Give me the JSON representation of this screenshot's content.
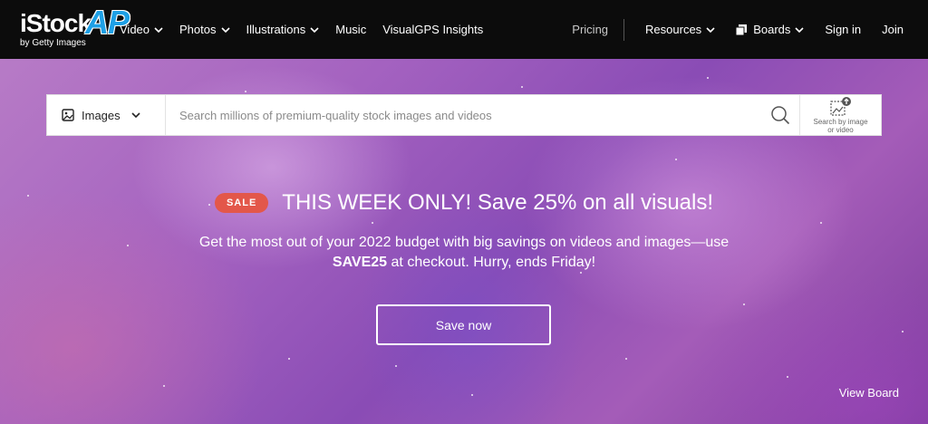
{
  "brand": {
    "logo_text": "iStock",
    "logo_overlay": "AP",
    "tagline": "by Getty Images"
  },
  "nav": {
    "left": [
      {
        "label": "Video",
        "has_chevron": true
      },
      {
        "label": "Photos",
        "has_chevron": true
      },
      {
        "label": "Illustrations",
        "has_chevron": true
      },
      {
        "label": "Music",
        "has_chevron": false
      },
      {
        "label": "VisualGPS Insights",
        "has_chevron": false
      }
    ],
    "pricing": "Pricing",
    "resources": "Resources",
    "boards": "Boards",
    "sign_in": "Sign in",
    "join": "Join"
  },
  "search": {
    "type_label": "Images",
    "placeholder": "Search millions of premium-quality stock images and videos",
    "value": "",
    "search_by_image_line1": "Search by image",
    "search_by_image_line2": "or video"
  },
  "promo": {
    "badge": "SALE",
    "headline": "THIS WEEK ONLY! Save 25% on all visuals!",
    "body_before": "Get the most out of your 2022 budget with big savings on videos and images—use",
    "code": "SAVE25",
    "body_after": "at checkout. Hurry, ends Friday!",
    "cta": "Save now"
  },
  "view_board": "View Board",
  "colors": {
    "nav_bg": "#0c0c0c",
    "sale_badge": "#e3574a",
    "logo_accent": "#1ea0e6"
  }
}
